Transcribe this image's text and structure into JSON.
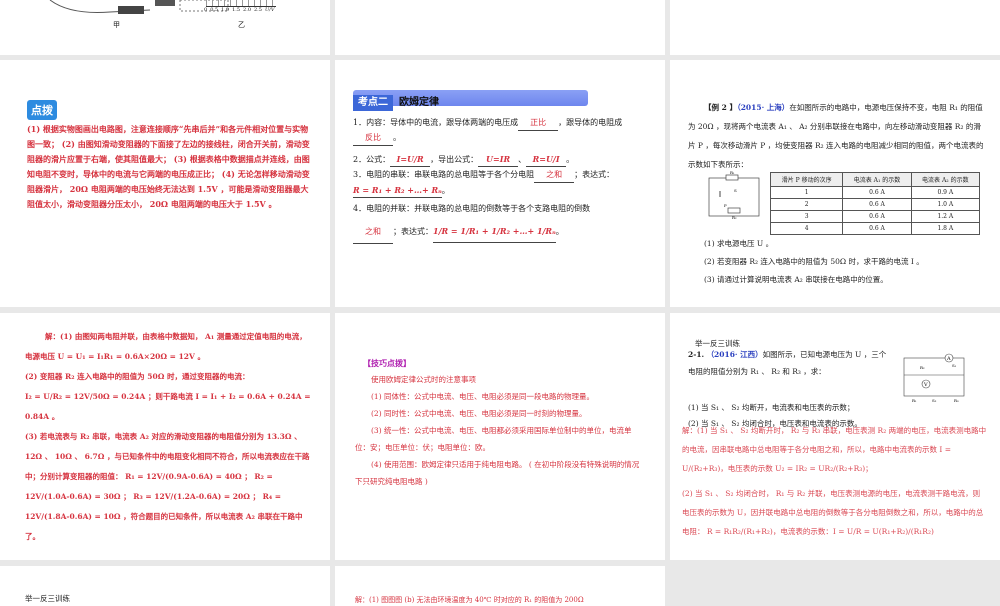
{
  "p1": {
    "label_jia": "甲",
    "label_yi": "乙",
    "axis_ticks": [
      "0",
      "0.5",
      "1.0",
      "1.5",
      "2.0",
      "2.5"
    ],
    "axis_unit": "U/V"
  },
  "p4": {
    "badge": "点拨",
    "text": "(1) 根据实物图画出电路图，注意连接顺序“先串后并”和各元件相对位置与实物图一致； (2) 由图知滑动变阻器的下面接了左边的接线柱，闭合开关前，滑动变阻器的滑片应置于右端，使其阻值最大； (3) 根据表格中数据描点并连线，由图知电阻不变时，导体中的电流与它两端的电压成正比； (4) 无论怎样移动滑动变阻器滑片， 20Ω 电阻两端的电压始终无法达到 1.5V ，可能是滑动变阻器最大阻值太小，滑动变阻器分压太小， 20Ω 电阻两端的电压大于 1.5V 。"
  },
  "p5": {
    "tag": "考点二",
    "title": "欧姆定律",
    "l1": "1．内容：导体中的电流，跟导体两端的电压成",
    "a1": "正比",
    "l1b": "，跟导体的电阻成",
    "a1b": "反比",
    "l2": "2．公式：",
    "a2": "I=U/R",
    "l2b": "，导出公式：",
    "a2b": "U=IR",
    "a2c": "R=U/I",
    "l3": "3．电阻的串联：串联电路的总电阻等于各个分电阻",
    "a3": "之和",
    "l3b": "；表达式：",
    "a3b": "R = R₁ + R₂ +…+ Rₙ",
    "l4": "4．电阻的并联：并联电路的总电阻的倒数等于各个支路电阻的倒数",
    "a4": "之和",
    "l4b": "；表达式：",
    "a4b": "1/R = 1/R₁ + 1/R₂ +…+ 1/Rₙ"
  },
  "p6": {
    "ex": "【例 2 】",
    "src": "（2015· 上海）",
    "stem": "在如图所示的电路中，电源电压保持不变，电阻 R₁ 的阻值为 20Ω ，现将两个电流表 A₁ 、 A₂ 分别串联接在电路中，向左移动滑动变阻器 R₂ 的滑片 P ，每次移动滑片 P ，均使变阻器 R₂ 连入电路的电阻减少相同的阻值，两个电流表的示数如下表所示：",
    "table": {
      "headers": [
        "滑片 P 移动的次序",
        "电流表 A₁ 的示数",
        "电流表 A₂ 的示数"
      ],
      "rows": [
        [
          "1",
          "0.6 A",
          "0.9 A"
        ],
        [
          "2",
          "0.6 A",
          "1.0 A"
        ],
        [
          "3",
          "0.6 A",
          "1.2 A"
        ],
        [
          "4",
          "0.6 A",
          "1.8 A"
        ]
      ]
    },
    "q1": "(1) 求电源电压 U 。",
    "q2": "(2) 若变阻器 R₂ 连入电路中的阻值为 50Ω 时，求干路的电流 I 。",
    "q3": "(3) 请通过计算说明电流表 A₂ 串联接在电路中的位置。",
    "r1": "R₁",
    "r2": "R₂",
    "s": "S",
    "p": "P"
  },
  "p7": {
    "a1": "解：(1) 由图知两电阻并联，由表格中数据知， A₁ 测量通过定值电阻的电流，电源电压 U = U₁ = I₁R₁ = 0.6A×20Ω = 12V 。",
    "a2": "(2) 变阻器 R₂ 连入电路中的阻值为 50Ω 时，通过变阻器的电流：",
    "a2b": "I₂ = U/R₂ = 12V/50Ω = 0.24A ；则干路电流 I = I₁ + I₂ = 0.6A + 0.24A = 0.84A 。",
    "a3": "(3) 若电流表与 R₂ 串联，电流表 A₂ 对应的滑动变阻器的电阻值分别为 13.3Ω 、 12Ω 、 10Ω 、 6.7Ω ，与已知条件中的电阻变化相同不符合，所以电流表应在干路中；分别计算变阻器的阻值： R₁ = 12V/(0.9A-0.6A) = 40Ω ； R₂ = 12V/(1.0A-0.6A) = 30Ω ； R₃ = 12V/(1.2A-0.6A) = 20Ω ； R₄ = 12V/(1.8A-0.6A) = 10Ω ，符合题目的已知条件，所以电流表 A₂ 串联在干路中了。"
  },
  "p8": {
    "title": "【技巧点拨】",
    "intro": "使用欧姆定律公式时的注意事项",
    "i1": "(1) 同体性：公式中电流、电压、电阻必须是同一段电路的物理量。",
    "i2": "(2) 同时性：公式中电流、电压、电阻必须是同一时刻的物理量。",
    "i3": "(3) 统一性：公式中电流、电压、电阻都必须采用国际单位制中的单位，电流单位：安；电压单位：伏；电阻单位：欧。",
    "i4": "(4) 使用范围：欧姆定律只适用于纯电阻电路。 ( 在初中阶段没有特殊说明的情况下只研究纯电阻电路 )"
  },
  "p9": {
    "head": "举一反三训练",
    "num": "2-1.",
    "src": "（2016· 江西）",
    "stem": "如图所示，已知电源电压为 U ，三个电阻的阻值分别为 R₁ 、 R₂ 和 R₃ ，求：",
    "q1": "(1) 当 S₁ 、 S₂ 均断开，电流表和电压表的示数；",
    "q2": "(2) 当 S₁ 、 S₂ 均闭合时，电压表和电流表的示数。",
    "a1": "解：(1) 当 S₁ 、 S₂ 均断开时， R₂ 与 R₃ 串联，电压表测 R₂ 两端的电压，电流表测电路中的电流，因串联电路中总电阻等于各分电阻之和，所以，电路中电流表的示数 I = U/(R₂+R₃)，电压表的示数 U₂ = IR₂ = UR₂/(R₂+R₃)；",
    "a2": "(2) 当 S₁ 、 S₂ 均闭合时， R₁ 与 R₂ 并联，电压表测电源的电压，电流表测干路电流，则电压表的示数为 U，因并联电路中总电阻的倒数等于各分电阻倒数之和，所以，电路中的总电阻： R = R₁R₂/(R₁+R₂)，电流表的示数：I = U/R = U(R₁+R₂)/(R₁R₂)",
    "labels": [
      "A",
      "V",
      "R₁",
      "R₂",
      "R₃",
      "S₁",
      "S₂"
    ]
  },
  "p10": {
    "head": "举一反三训练"
  },
  "p11": {
    "text": "解：(1) 图图图 (b) 无法由环境温度为 40℃ 时对应的 R₁ 的阻值为 200Ω"
  }
}
